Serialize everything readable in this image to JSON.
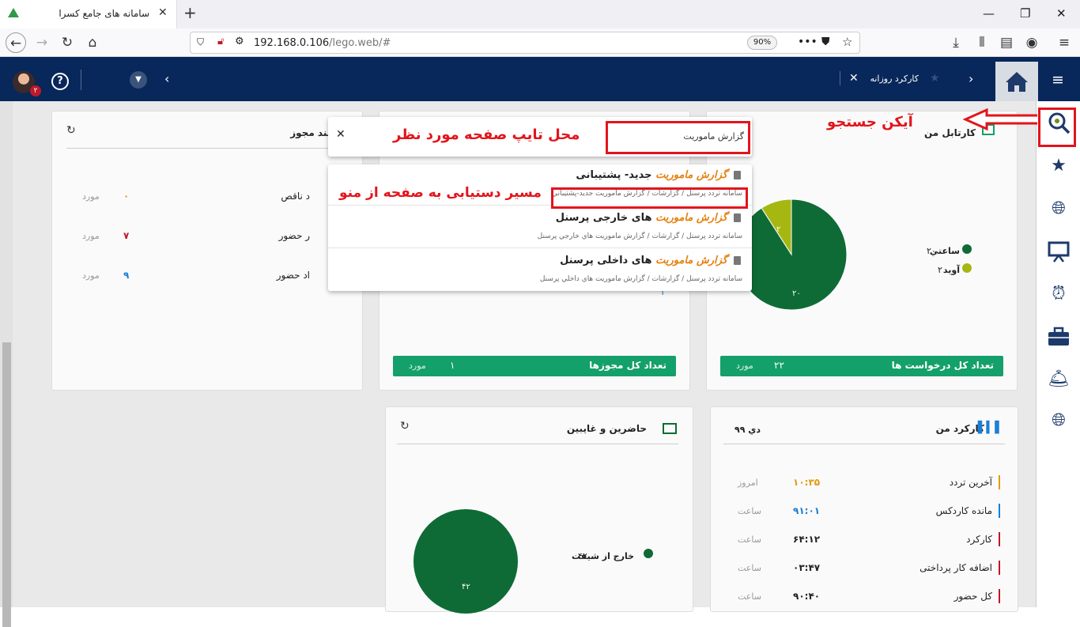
{
  "browser": {
    "tab_title": "سامانه های جامع کسرا",
    "tab_close": "✕",
    "new_tab": "+",
    "url_host": "192.168.0.106",
    "url_path": "/lego.web/#",
    "zoom": "90%"
  },
  "header": {
    "avatar_badge": "۲",
    "help": "?",
    "open_tab_label": "کارکرد روزانه",
    "open_tab_close": "✕"
  },
  "search": {
    "value": "گزارش ماموریت",
    "close": "✕",
    "results": [
      {
        "highlight": "گزارش ماموریت",
        "rest": " جدید- پشتیبانی",
        "path": "سامانه تردد پرسنل / گزارشات / گزارش ماموريت جديد-پشتيباني"
      },
      {
        "highlight": "گزارش ماموریت",
        "rest": " های خارجی پرسنل",
        "path": "سامانه تردد پرسنل / گزارشات / گزارش ماموريت هاي خارجي پرسنل"
      },
      {
        "highlight": "گزارش ماموریت",
        "rest": " های داخلی پرسنل",
        "path": "سامانه تردد پرسنل / گزارشات / گزارش ماموريت هاي داخلي پرسنل"
      }
    ]
  },
  "annotations": {
    "search_icon": "آیکن جستجو",
    "type_here": "محل تایپ صفحه مورد نظر",
    "menu_path": "مسیر دستیابی به صفحه  از منو"
  },
  "cards": {
    "permits_needed": {
      "title": "نیازمند مجوز",
      "rows": [
        {
          "label": "د ناقص",
          "value": "۰",
          "unit": "مورد",
          "color": "#e59a0e"
        },
        {
          "label": "ر حضور",
          "value": "۷",
          "unit": "مورد",
          "color": "#c0172a"
        },
        {
          "label": "اد حضور",
          "value": "۹",
          "unit": "مورد",
          "color": "#1a7fd6"
        }
      ]
    },
    "permits_total": {
      "label": "تعداد کل مجوزها",
      "value": "۱",
      "unit": "مورد",
      "stray": "۱"
    },
    "my_cartable": {
      "title": "کارتابل من",
      "legend": [
        {
          "label": "ساعتي",
          "value": "۲۰",
          "color": "#0f6b36"
        },
        {
          "label": "آويد",
          "value": "۲",
          "color": "#a6b712"
        }
      ],
      "pie_labels": {
        "big": "۲۰",
        "small": "۲"
      },
      "total_label": "تعداد کل درخواست ها",
      "total_value": "۲۲",
      "total_unit": "مورد"
    },
    "presence": {
      "title": "حاضرین و غایبین",
      "legend": [
        {
          "label": "خارج از شیفت",
          "value": "۴۲",
          "color": "#0f6b36"
        }
      ],
      "pie_label": "۴۲"
    },
    "my_work": {
      "title": "کارکرد من",
      "month": "دي ۹۹",
      "rows": [
        {
          "label": "آخرین تردد",
          "value": "۱۰:۳۵",
          "unit": "امروز",
          "bar": "#e59a0e",
          "vcolor": "#e59a0e"
        },
        {
          "label": "مانده کاردکس",
          "value": "۹۱:۰۱",
          "unit": "ساعت",
          "bar": "#1a7fd6",
          "vcolor": "#1a7fd6"
        },
        {
          "label": "کارکرد",
          "value": "۶۴:۱۲",
          "unit": "ساعت",
          "bar": "#c0172a",
          "vcolor": "#222"
        },
        {
          "label": "اضافه کار پرداختی",
          "value": "۰۳:۴۷",
          "unit": "ساعت",
          "bar": "#c0172a",
          "vcolor": "#222"
        },
        {
          "label": "کل حضور",
          "value": "۹۰:۴۰",
          "unit": "ساعت",
          "bar": "#c0172a",
          "vcolor": "#222"
        }
      ]
    }
  },
  "chart_data": [
    {
      "type": "pie",
      "categories": [
        "ساعتي",
        "آويد"
      ],
      "values": [
        20,
        2
      ]
    },
    {
      "type": "pie",
      "categories": [
        "خارج از شیفت"
      ],
      "values": [
        42
      ]
    }
  ]
}
